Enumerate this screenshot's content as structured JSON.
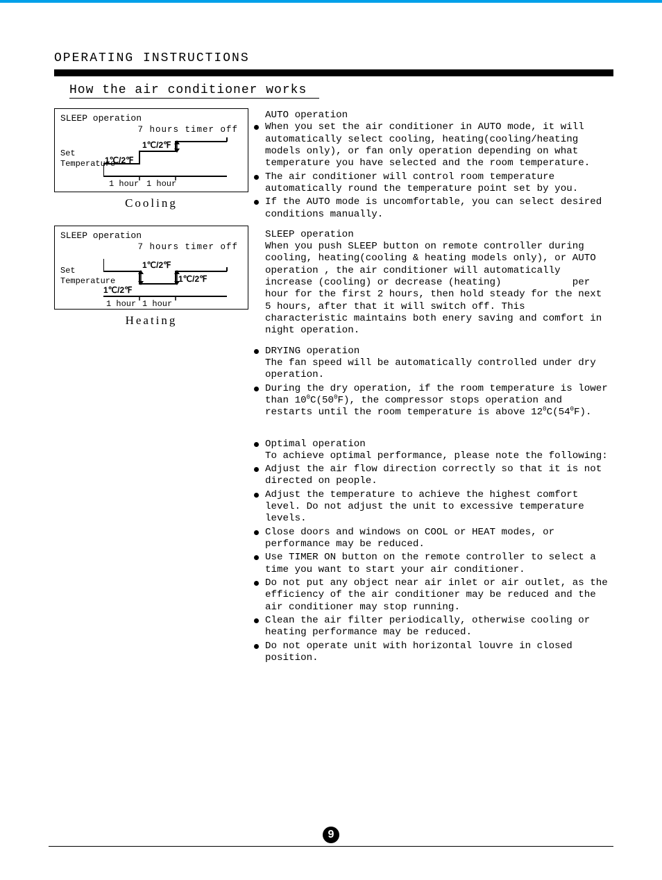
{
  "header": {
    "section": "OPERATING INSTRUCTIONS",
    "subtitle": "How the air conditioner works"
  },
  "diagrams": {
    "cooling": {
      "title": "SLEEP  operation",
      "timer": "7 hours timer off",
      "side1": "Set",
      "side2": "Temperature",
      "step1": "1℃/2℉",
      "step2": "1℃/2℉",
      "hr1": "1 hour",
      "hr2": "1 hour",
      "caption": "Cooling"
    },
    "heating": {
      "title": "SLEEP  operation",
      "timer": "7 hours timer off",
      "side1": "Set",
      "side2": "Temperature",
      "step1": "1℃/2℉",
      "step2": "1℃/2℉",
      "step3": "1℃/2℉",
      "hr1": "1 hour",
      "hr2": "1 hour",
      "caption": "Heating"
    }
  },
  "text": {
    "auto_head": "AUTO operation",
    "auto_b1": "When you set the air conditioner in AUTO mode, it will automatically select cooling, heating(cooling/heating models only), or fan only operation depending on what temperature you have selected and the room temperature.",
    "auto_b2": "The air conditioner will control room temperature automatically round the temperature point set by you.",
    "auto_b3": "If the AUTO mode is uncomfortable, you can select desired conditions manually.",
    "sleep_head": "SLEEP operation",
    "sleep_p": "When you push SLEEP button on remote controller during cooling, heating(cooling & heating models only), or AUTO operation , the air conditioner will automatically increase (cooling) or decrease (heating)            per hour for the first 2 hours, then hold steady for the next 5 hours, after that it will switch off. This characteristic maintains both enery saving and comfort in night operation.",
    "dry_head": "DRYING operation",
    "dry_p": "The fan speed will be automatically controlled under dry operation.",
    "dry_b2a": "During the dry operation, if the room temperature is lower than 10",
    "dry_b2b": "C(50",
    "dry_b2c": "F), the compressor stops operation and restarts until the room temperature is above 12",
    "dry_b2d": "C(54",
    "dry_b2e": "F).",
    "opt_head": "Optimal operation",
    "opt_intro": "To achieve optimal performance, please note the following:",
    "opt_b1": "Adjust the air flow direction correctly so that it is not directed on people.",
    "opt_b2": "Adjust the temperature to achieve the highest comfort level. Do not adjust the unit to excessive temperature levels.",
    "opt_b3": "Close doors and windows on COOL or HEAT modes, or performance may be reduced.",
    "opt_b4": "Use TIMER ON button on the remote controller to select a time you want to start your air conditioner.",
    "opt_b5": "Do not put any object near air inlet or air outlet, as the efficiency of the air conditioner may be reduced and the air conditioner may stop running.",
    "opt_b6": "Clean the air filter periodically, otherwise cooling or heating performance may be reduced.",
    "opt_b7": "Do not operate unit with horizontal louvre in closed position."
  },
  "page_number": "9"
}
